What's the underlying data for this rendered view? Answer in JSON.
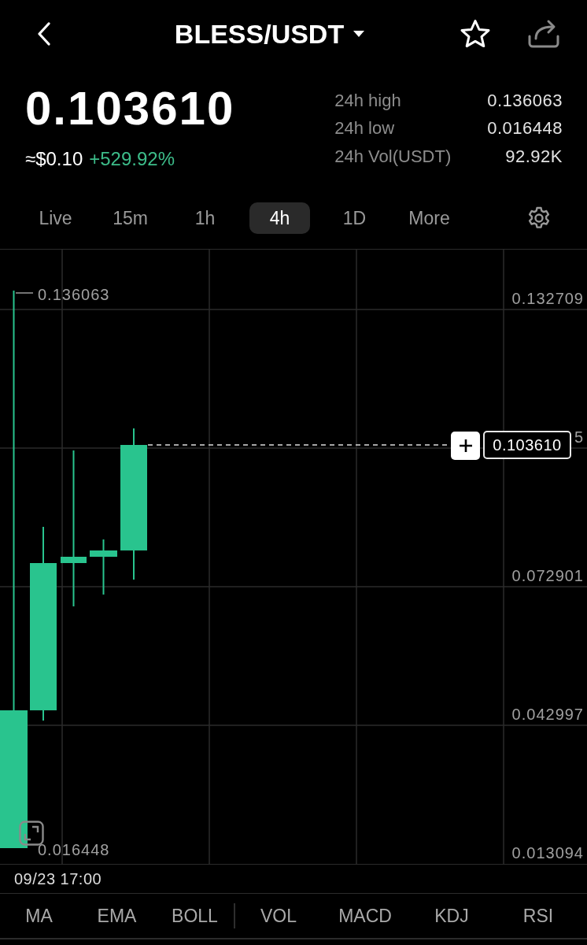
{
  "header": {
    "title": "BLESS/USDT"
  },
  "ticker": {
    "price": "0.103610",
    "usd_value": "≈$0.10",
    "change": "+529.92%",
    "stats": [
      {
        "label": "24h high",
        "value": "0.136063"
      },
      {
        "label": "24h low",
        "value": "0.016448"
      },
      {
        "label": "24h Vol(USDT)",
        "value": "92.92K"
      }
    ]
  },
  "intervals": [
    {
      "label": "Live",
      "selected": false
    },
    {
      "label": "15m",
      "selected": false
    },
    {
      "label": "1h",
      "selected": false
    },
    {
      "label": "4h",
      "selected": true
    },
    {
      "label": "1D",
      "selected": false
    },
    {
      "label": "More",
      "selected": false
    }
  ],
  "chart": {
    "y_axis_labels": [
      "0.132709",
      "5",
      "0.072901",
      "0.042997",
      "0.013094"
    ],
    "high_label": "0.136063",
    "low_label": "0.016448",
    "last_price": "0.103610",
    "time_label": "09/23 17:00"
  },
  "indicators": {
    "main": [
      "MA",
      "EMA",
      "BOLL"
    ],
    "sub": [
      "VOL",
      "MACD",
      "KDJ",
      "RSI"
    ]
  }
}
